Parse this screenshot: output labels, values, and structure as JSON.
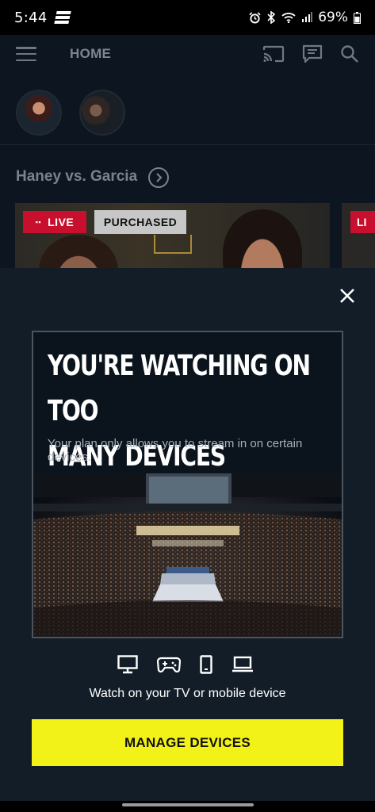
{
  "status_bar": {
    "time": "5:44",
    "battery": "69%",
    "icons": [
      "app-logo-icon",
      "alarm-icon",
      "bluetooth-icon",
      "wifi-icon",
      "signal-icon",
      "battery-icon"
    ]
  },
  "header": {
    "title": "HOME",
    "icons": [
      "menu-icon",
      "cast-icon",
      "chat-icon",
      "search-icon"
    ]
  },
  "section": {
    "title": "Haney vs. Garcia"
  },
  "card": {
    "live_badge": "LIVE",
    "purchased_badge": "PURCHASED",
    "live_badge_2": "LI"
  },
  "modal": {
    "headline_line1": "YOU'RE WATCHING ON TOO",
    "headline_line2": "MANY DEVICES",
    "body": "Your plan only allows you to stream in on certain devices.",
    "device_icons": [
      "desktop-icon",
      "gamepad-icon",
      "phone-icon",
      "laptop-icon"
    ],
    "watch_text": "Watch on your TV or mobile device",
    "button_label": "MANAGE DEVICES"
  },
  "colors": {
    "accent_button": "#f2f218",
    "live_red": "#c8102e",
    "modal_bg": "#121d28"
  }
}
